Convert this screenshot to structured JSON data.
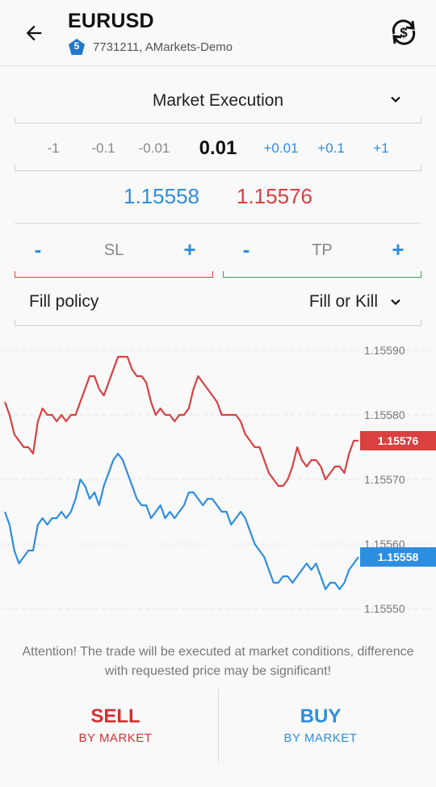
{
  "header": {
    "symbol": "EURUSD",
    "badge": "5",
    "account": "7731211, AMarkets-Demo"
  },
  "order": {
    "execution_type": "Market Execution",
    "volume_steps": [
      "-1",
      "-0.1",
      "-0.01",
      "+0.01",
      "+0.1",
      "+1"
    ],
    "volume": "0.01",
    "bid": "1.15558",
    "ask": "1.15576",
    "sl": {
      "label": "SL",
      "minus": "-",
      "plus": "+"
    },
    "tp": {
      "label": "TP",
      "minus": "-",
      "plus": "+"
    },
    "fill_policy_label": "Fill policy",
    "fill_policy_value": "Fill or Kill"
  },
  "chart_data": {
    "type": "line",
    "ylim": [
      1.15547,
      1.15592
    ],
    "yticks": [
      "1.15590",
      "1.15580",
      "1.15570",
      "1.15560",
      "1.15550"
    ],
    "tick_values": [
      1.1559,
      1.1558,
      1.1557,
      1.1556,
      1.1555
    ],
    "series": [
      {
        "color": "#d94040",
        "last_label": "1.15576",
        "values": [
          1.15582,
          1.1558,
          1.15577,
          1.15576,
          1.15575,
          1.15575,
          1.15574,
          1.15579,
          1.15581,
          1.1558,
          1.1558,
          1.15579,
          1.1558,
          1.15579,
          1.1558,
          1.1558,
          1.15582,
          1.15584,
          1.15586,
          1.15586,
          1.15584,
          1.15583,
          1.15585,
          1.15587,
          1.15589,
          1.15589,
          1.15589,
          1.15587,
          1.15586,
          1.15586,
          1.15585,
          1.15582,
          1.1558,
          1.15581,
          1.1558,
          1.1558,
          1.15579,
          1.1558,
          1.1558,
          1.15581,
          1.15584,
          1.15586,
          1.15585,
          1.15584,
          1.15583,
          1.15582,
          1.1558,
          1.1558,
          1.1558,
          1.1558,
          1.15579,
          1.15577,
          1.15576,
          1.15575,
          1.15575,
          1.15573,
          1.15571,
          1.1557,
          1.15569,
          1.15569,
          1.1557,
          1.15572,
          1.15575,
          1.15573,
          1.15572,
          1.15573,
          1.15573,
          1.15572,
          1.1557,
          1.15571,
          1.15572,
          1.15572,
          1.15571,
          1.15574,
          1.15576,
          1.15576
        ]
      },
      {
        "color": "#2d8ee0",
        "last_label": "1.15558",
        "values": [
          1.15565,
          1.15563,
          1.15559,
          1.15557,
          1.15558,
          1.15559,
          1.15559,
          1.15563,
          1.15564,
          1.15563,
          1.15564,
          1.15564,
          1.15565,
          1.15564,
          1.15565,
          1.15567,
          1.1557,
          1.15569,
          1.15567,
          1.15568,
          1.15566,
          1.15569,
          1.15571,
          1.15573,
          1.15574,
          1.15573,
          1.15571,
          1.15569,
          1.15567,
          1.15566,
          1.15566,
          1.15564,
          1.15565,
          1.15566,
          1.15564,
          1.15565,
          1.15564,
          1.15565,
          1.15566,
          1.15568,
          1.15568,
          1.15567,
          1.15566,
          1.15567,
          1.15567,
          1.15566,
          1.15565,
          1.15565,
          1.15563,
          1.15564,
          1.15565,
          1.15564,
          1.15562,
          1.1556,
          1.15559,
          1.15558,
          1.15556,
          1.15554,
          1.15554,
          1.15555,
          1.15555,
          1.15554,
          1.15555,
          1.15556,
          1.15557,
          1.15556,
          1.15557,
          1.15555,
          1.15553,
          1.15554,
          1.15554,
          1.15553,
          1.15554,
          1.15556,
          1.15557,
          1.15558
        ]
      }
    ]
  },
  "notice": "Attention! The trade will be executed at market conditions, difference with requested price may be significant!",
  "actions": {
    "sell_label": "SELL",
    "sell_sub": "BY MARKET",
    "buy_label": "BUY",
    "buy_sub": "BY MARKET"
  }
}
